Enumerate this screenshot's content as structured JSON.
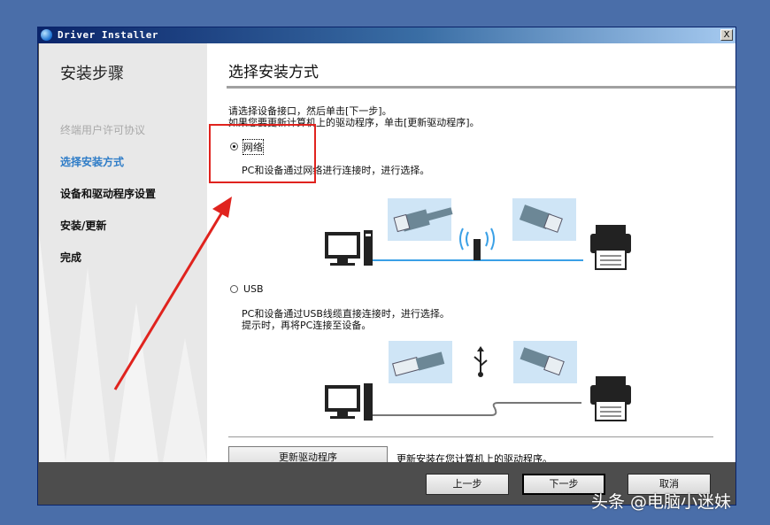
{
  "window": {
    "title": "Driver Installer",
    "close_glyph": "X"
  },
  "sidebar": {
    "title": "安装步骤",
    "steps": [
      {
        "label": "终端用户许可协议",
        "state": "done"
      },
      {
        "label": "选择安装方式",
        "state": "current"
      },
      {
        "label": "设备和驱动程序设置",
        "state": "todo"
      },
      {
        "label": "安装/更新",
        "state": "todo"
      },
      {
        "label": "完成",
        "state": "todo"
      }
    ]
  },
  "main": {
    "title": "选择安装方式",
    "instructions": [
      "请选择设备接口，然后单击[下一步]。",
      "如果您要更新计算机上的驱动程序，单击[更新驱动程序]。"
    ],
    "options": [
      {
        "label": "网络",
        "selected": true,
        "description": [
          "PC和设备通过网络进行连接时，进行选择。"
        ]
      },
      {
        "label": "USB",
        "selected": false,
        "description": [
          "PC和设备通过USB线缆直接连接时，进行选择。",
          "提示时，再将PC连接至设备。"
        ]
      }
    ],
    "update_button": "更新驱动程序",
    "update_description": "更新安装在您计算机上的驱动程序。"
  },
  "footer": {
    "back": "上一步",
    "next": "下一步",
    "cancel": "取消"
  },
  "watermark": "头条 @电脑小迷妹",
  "colors": {
    "accent": "#2e7cc7",
    "annotation": "#e0231e",
    "network_line": "#3aa0e6"
  }
}
